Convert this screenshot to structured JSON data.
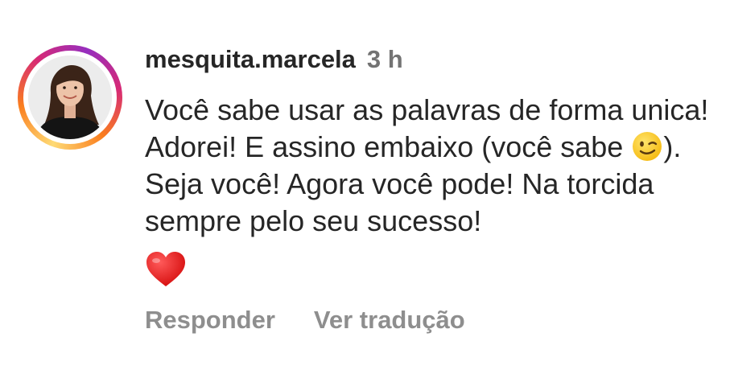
{
  "comment": {
    "username": "mesquita.marcela",
    "time": "3 h",
    "avatar_icon": "profile-photo-woman",
    "ring_colors": [
      "#feda75",
      "#fa7e1e",
      "#d62976",
      "#962fbf"
    ],
    "text_parts": [
      "Você sabe usar as palavras de forma unica! Adorei! E assino embaixo (você sabe ",
      "). Seja você! Agora você pode! Na torcida sempre pelo seu sucesso!"
    ],
    "emoji_inline": "winking-face-emoji",
    "emoji_trailing": "red-heart-emoji"
  },
  "actions": {
    "reply_label": "Responder",
    "translate_label": "Ver tradução"
  }
}
